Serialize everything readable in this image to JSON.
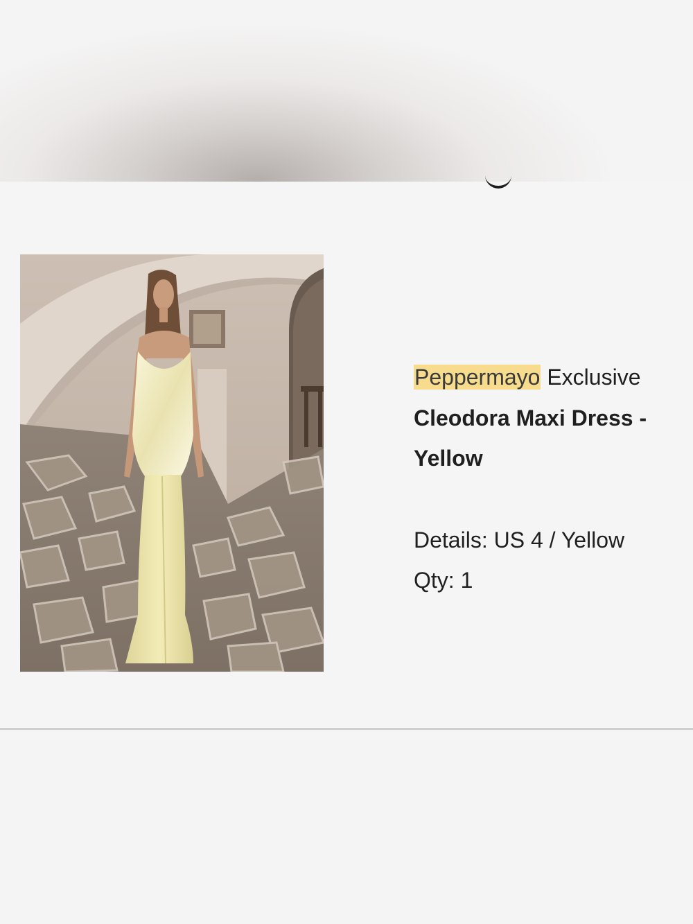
{
  "order_item": {
    "brand": "Peppermayo",
    "brand_suffix": "Exclusive",
    "name_line1": "Cleodora Maxi Dress -",
    "name_line2": "Yellow",
    "details_label": "Details:",
    "details_value": "US 4 / Yellow",
    "qty_label": "Qty:",
    "qty_value": "1"
  },
  "colors": {
    "highlight": "#f7dc8d",
    "dress": "#efe7a6",
    "background": "#f5f5f5"
  },
  "icons": {
    "product_image": "product-photo-woman-in-yellow-maxi-dress"
  }
}
